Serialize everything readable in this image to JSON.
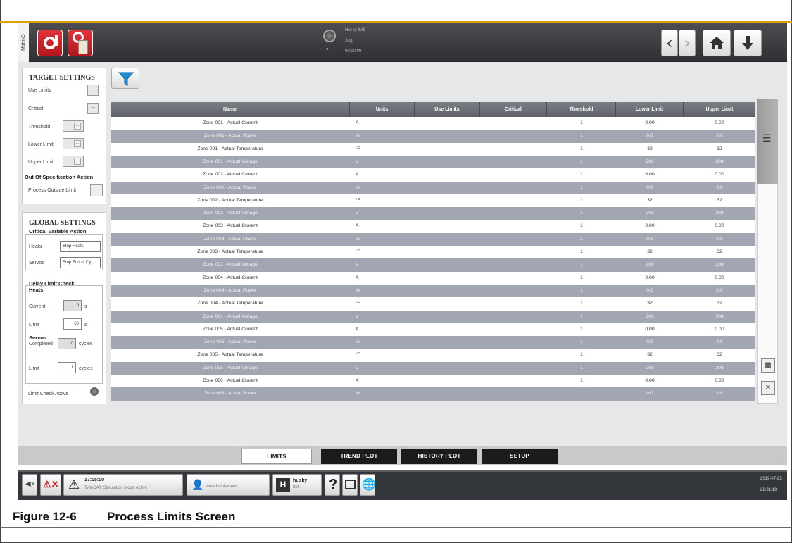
{
  "header": {
    "side_tab": "MatrixS",
    "status_title": "Husky IMS",
    "status_state": "Stop",
    "status_time": "00:00:00",
    "nav_icons": [
      "chevron-left-icon",
      "chevron-right-icon",
      "home-icon",
      "download-icon"
    ]
  },
  "target_settings": {
    "title": "TARGET SETTINGS",
    "use_limits": "Use Limits",
    "critical": "Critical",
    "threshold": "Threshold",
    "lower_limit": "Lower Limit",
    "upper_limit": "Upper Limit",
    "placeholder": "---",
    "oos_title": "Out Of Specification Action",
    "process_outside": "Process Outside Limit"
  },
  "global_settings": {
    "title": "GLOBAL SETTINGS",
    "critical_action": "Critical Variable Action",
    "heats_label": "Heats",
    "heats_value": "Stop Heats",
    "servos_label": "Servos",
    "servos_value": "Stop End of Cy...",
    "delay_title": "Delay Limit Check",
    "heats_sub": "Heats",
    "current_label": "Current",
    "current_value": "0",
    "current_unit": "s",
    "limit_label": "Limit",
    "limit_value": "60",
    "limit_unit": "s",
    "servos_sub": "Servos",
    "completed_label": "Completed",
    "completed_value": "0",
    "completed_unit": "cycles",
    "limit2_label": "Limit",
    "limit2_value": "1",
    "limit2_unit": "cycles",
    "limit_check_active": "Limit Check Active"
  },
  "table": {
    "columns": [
      "Name",
      "Units",
      "Use Limits",
      "Critical",
      "Threshold",
      "Lower Limit",
      "Upper Limit"
    ],
    "rows": [
      [
        "Zone 001 - Actual Current",
        "A",
        "",
        "",
        "1",
        "0.00",
        "0.00"
      ],
      [
        "Zone 001 - Actual Power",
        "%",
        "",
        "",
        "1",
        "0.0",
        "0.0"
      ],
      [
        "Zone 001 - Actual Temperature",
        "°F",
        "",
        "",
        "1",
        "32",
        "32"
      ],
      [
        "Zone 001 - Actual Voltage",
        "V",
        "",
        "",
        "1",
        "208",
        "208"
      ],
      [
        "Zone 002 - Actual Current",
        "A",
        "",
        "",
        "1",
        "0.00",
        "0.00"
      ],
      [
        "Zone 002 - Actual Power",
        "%",
        "",
        "",
        "1",
        "0.0",
        "0.0"
      ],
      [
        "Zone 002 - Actual Temperature",
        "°F",
        "",
        "",
        "1",
        "32",
        "32"
      ],
      [
        "Zone 002 - Actual Voltage",
        "V",
        "",
        "",
        "1",
        "208",
        "208"
      ],
      [
        "Zone 003 - Actual Current",
        "A",
        "",
        "",
        "1",
        "0.00",
        "0.00"
      ],
      [
        "Zone 003 - Actual Power",
        "%",
        "",
        "",
        "1",
        "0.0",
        "0.0"
      ],
      [
        "Zone 003 - Actual Temperature",
        "°F",
        "",
        "",
        "1",
        "32",
        "32"
      ],
      [
        "Zone 003 - Actual Voltage",
        "V",
        "",
        "",
        "1",
        "208",
        "208"
      ],
      [
        "Zone 004 - Actual Current",
        "A",
        "",
        "",
        "1",
        "0.00",
        "0.00"
      ],
      [
        "Zone 004 - Actual Power",
        "%",
        "",
        "",
        "1",
        "0.0",
        "0.0"
      ],
      [
        "Zone 004 - Actual Temperature",
        "°F",
        "",
        "",
        "1",
        "32",
        "32"
      ],
      [
        "Zone 004 - Actual Voltage",
        "V",
        "",
        "",
        "1",
        "208",
        "208"
      ],
      [
        "Zone 005 - Actual Current",
        "A",
        "",
        "",
        "1",
        "0.00",
        "0.00"
      ],
      [
        "Zone 005 - Actual Power",
        "%",
        "",
        "",
        "1",
        "0.0",
        "0.0"
      ],
      [
        "Zone 005 - Actual Temperature",
        "°F",
        "",
        "",
        "1",
        "32",
        "32"
      ],
      [
        "Zone 005 - Actual Voltage",
        "V",
        "",
        "",
        "1",
        "208",
        "208"
      ],
      [
        "Zone 006 - Actual Current",
        "A",
        "",
        "",
        "1",
        "0.00",
        "0.00"
      ],
      [
        "Zone 006 - Actual Power",
        "%",
        "",
        "",
        "1",
        "0.0",
        "0.0"
      ]
    ]
  },
  "tabs": [
    "LIMITS",
    "TREND PLOT",
    "HISTORY PLOT",
    "SETUP"
  ],
  "taskbar": {
    "alarm_time": "17:05:00",
    "alarm_text": "TwinCAT: Simulation Mode Active",
    "user": "hmiadministrator",
    "mold_title": "husky",
    "mold_sub": "test",
    "help": "?",
    "date": "2019-07-25",
    "time": "22:31:19"
  },
  "caption": {
    "number": "Figure 12-6",
    "title": "Process Limits Screen"
  },
  "colors": {
    "accent": "#e0a100",
    "alarm_red": "#c9252b",
    "filter_blue": "#1a8fd6",
    "row_alt": "#a2a6b3"
  }
}
